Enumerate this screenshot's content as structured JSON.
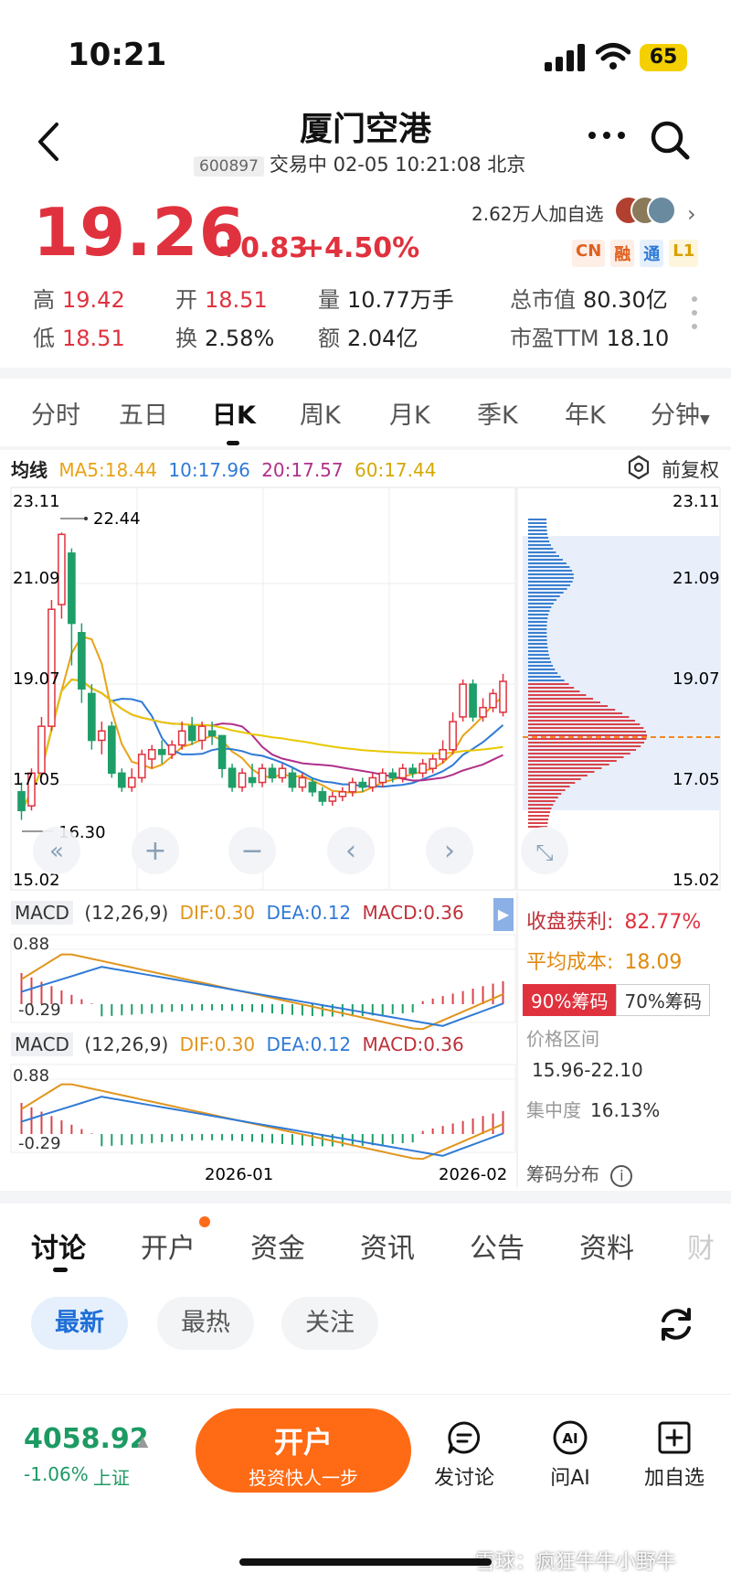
{
  "status_bar": {
    "time": "10:21",
    "battery": "65"
  },
  "header": {
    "title": "厦门空港",
    "code": "600897",
    "status": "交易中 02-05 10:21:08 北京"
  },
  "quote": {
    "price": "19.26",
    "change": "+0.83",
    "change_pct": "+4.50%",
    "watchers": "2.62万人加自选",
    "badges": [
      "CN",
      "融",
      "通",
      "L1"
    ],
    "stats": [
      {
        "k": "高",
        "v": "19.42",
        "red": true
      },
      {
        "k": "开",
        "v": "18.51",
        "red": true
      },
      {
        "k": "量",
        "v": "10.77万手",
        "red": false
      },
      {
        "k": "总市值",
        "v": "80.30亿",
        "red": false
      },
      {
        "k": "低",
        "v": "18.51",
        "red": true
      },
      {
        "k": "换",
        "v": "2.58%",
        "red": false
      },
      {
        "k": "额",
        "v": "2.04亿",
        "red": false
      },
      {
        "k": "市盈TTM",
        "v": "18.10",
        "red": false
      }
    ]
  },
  "chart_tabs": [
    "分时",
    "五日",
    "日K",
    "周K",
    "月K",
    "季K",
    "年K",
    "分钟"
  ],
  "chart_tab_active": "日K",
  "ma": {
    "label": "均线",
    "ma5": "MA5:18.44",
    "ma10": "10:17.96",
    "ma20": "20:17.57",
    "ma60": "60:17.44",
    "adjust": "前复权",
    "colors": {
      "ma5": "#e8a317",
      "ma10": "#2f7ad6",
      "ma20": "#b0308a",
      "ma60": "#e8c800"
    }
  },
  "chart_data": {
    "type": "candlestick",
    "title": "",
    "y_ticks": [
      "23.11",
      "21.09",
      "19.07",
      "17.05",
      "15.02"
    ],
    "ylim": [
      15.02,
      23.11
    ],
    "max_marker": "22.44",
    "min_marker": "16.30",
    "x_ticks": [
      "2026-01",
      "2026-02"
    ],
    "candles": [
      [
        16.9,
        16.5,
        17.1,
        16.3
      ],
      [
        16.6,
        17.3,
        17.4,
        16.5
      ],
      [
        17.3,
        18.3,
        18.5,
        17.2
      ],
      [
        18.3,
        20.8,
        21.0,
        18.2
      ],
      [
        20.9,
        22.4,
        22.44,
        20.6
      ],
      [
        22.0,
        20.5,
        22.1,
        19.6
      ],
      [
        20.3,
        19.1,
        20.5,
        18.8
      ],
      [
        19.0,
        18.0,
        19.2,
        17.8
      ],
      [
        18.0,
        18.2,
        18.4,
        17.7
      ],
      [
        18.3,
        17.3,
        18.4,
        17.2
      ],
      [
        17.3,
        17.0,
        17.4,
        16.9
      ],
      [
        17.0,
        17.2,
        17.4,
        16.9
      ],
      [
        17.2,
        17.7,
        17.8,
        17.1
      ],
      [
        17.6,
        17.8,
        17.9,
        17.4
      ],
      [
        17.8,
        17.7,
        18.0,
        17.5
      ],
      [
        17.7,
        17.9,
        18.0,
        17.6
      ],
      [
        17.9,
        18.2,
        18.4,
        17.8
      ],
      [
        18.3,
        18.0,
        18.5,
        17.9
      ],
      [
        18.0,
        18.3,
        18.4,
        17.8
      ],
      [
        18.2,
        18.1,
        18.4,
        17.9
      ],
      [
        18.1,
        17.4,
        18.1,
        17.2
      ],
      [
        17.4,
        17.0,
        17.5,
        16.9
      ],
      [
        17.0,
        17.3,
        17.4,
        16.9
      ],
      [
        17.2,
        17.1,
        17.5,
        17.0
      ],
      [
        17.1,
        17.4,
        17.5,
        17.0
      ],
      [
        17.4,
        17.2,
        17.5,
        17.1
      ],
      [
        17.2,
        17.4,
        17.5,
        17.1
      ],
      [
        17.3,
        17.0,
        17.4,
        16.9
      ],
      [
        17.0,
        17.2,
        17.3,
        16.9
      ],
      [
        17.1,
        16.9,
        17.2,
        16.8
      ],
      [
        16.9,
        16.7,
        17.0,
        16.6
      ],
      [
        16.7,
        16.8,
        16.9,
        16.6
      ],
      [
        16.8,
        16.9,
        17.0,
        16.7
      ],
      [
        16.9,
        17.1,
        17.2,
        16.8
      ],
      [
        17.1,
        17.0,
        17.2,
        16.9
      ],
      [
        17.0,
        17.2,
        17.3,
        16.9
      ],
      [
        17.1,
        17.3,
        17.4,
        17.0
      ],
      [
        17.3,
        17.2,
        17.4,
        17.1
      ],
      [
        17.2,
        17.4,
        17.5,
        17.1
      ],
      [
        17.4,
        17.3,
        17.5,
        17.2
      ],
      [
        17.3,
        17.5,
        17.6,
        17.2
      ],
      [
        17.4,
        17.6,
        17.7,
        17.3
      ],
      [
        17.6,
        17.8,
        18.0,
        17.5
      ],
      [
        17.8,
        18.4,
        18.6,
        17.7
      ],
      [
        18.5,
        19.2,
        19.3,
        18.4
      ],
      [
        19.2,
        18.5,
        19.3,
        18.4
      ],
      [
        18.5,
        18.7,
        18.9,
        18.4
      ],
      [
        18.7,
        19.0,
        19.1,
        18.6
      ],
      [
        18.6,
        19.26,
        19.42,
        18.51
      ]
    ]
  },
  "chart_nav": [
    "«",
    "+",
    "−",
    "‹",
    "›",
    "⤡"
  ],
  "chips": {
    "profit_label": "收盘获利:",
    "profit_value": "82.77%",
    "avg_label": "平均成本:",
    "avg_value": "18.09",
    "pill_on": "90%筹码",
    "pill_off": "70%筹码",
    "range_label": "价格区间",
    "range_value": "15.96-22.10",
    "conc_label": "集中度",
    "conc_value": "16.13%",
    "dist_label": "筹码分布"
  },
  "macd": {
    "label": "MACD",
    "params": "(12,26,9)",
    "dif": "DIF:0.30",
    "dea": "DEA:0.12",
    "macd": "MACD:0.36",
    "top": "0.88",
    "bottom": "-0.29"
  },
  "discussion_tabs": [
    "讨论",
    "开户",
    "资金",
    "资讯",
    "公告",
    "资料",
    "财"
  ],
  "filters": [
    "最新",
    "最热",
    "关注"
  ],
  "bottom": {
    "index_value": "4058.92",
    "index_change": "-1.06%",
    "index_name": "上证",
    "open_main": "开户",
    "open_sub": "投资快人一步",
    "post": "发讨论",
    "ask_ai": "问AI",
    "add_watch": "加自选"
  },
  "watermark": "雪球：疯狂牛牛小野牛"
}
